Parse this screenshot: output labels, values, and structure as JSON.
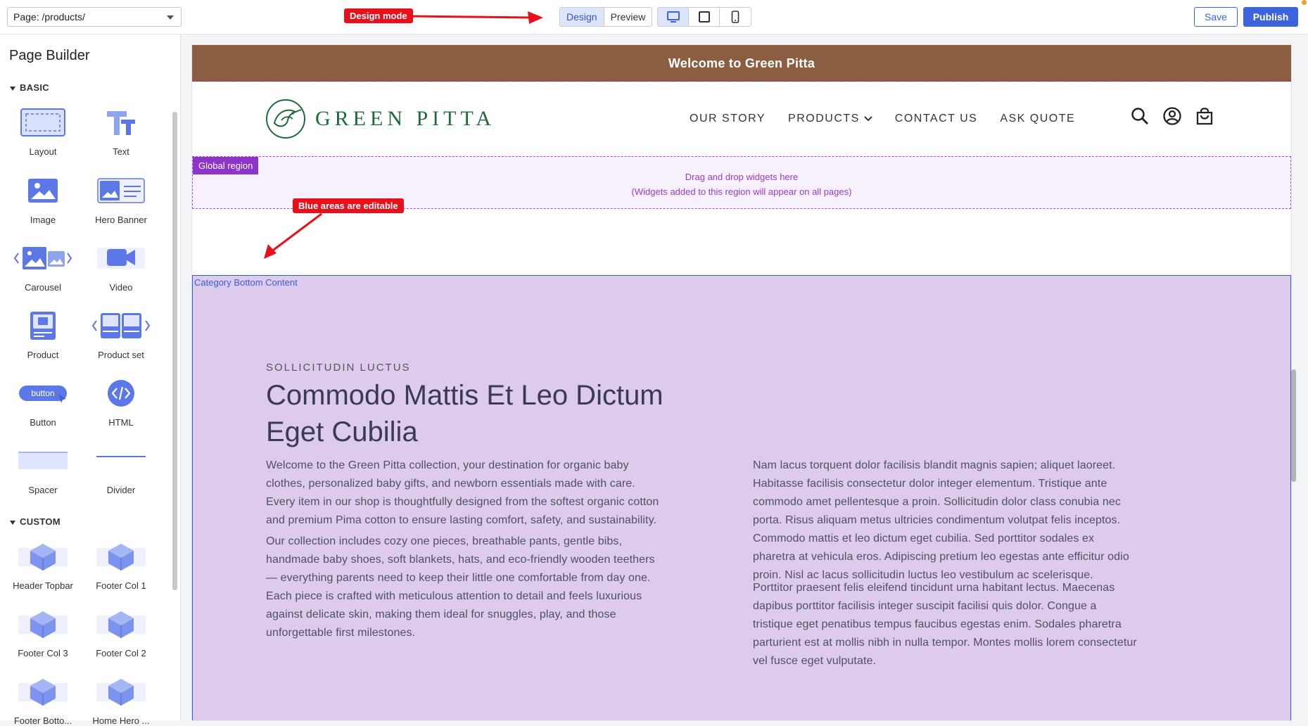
{
  "topbar": {
    "page_select": "Page: /products/",
    "callout_design": "Design mode",
    "mode_design": "Design",
    "mode_preview": "Preview",
    "save": "Save",
    "publish": "Publish"
  },
  "sidebar": {
    "title": "Page Builder",
    "basic_title": "BASIC",
    "custom_title": "CUSTOM",
    "basic": [
      {
        "label": "Layout",
        "icon": "layout-icon"
      },
      {
        "label": "Text",
        "icon": "text-icon"
      },
      {
        "label": "Image",
        "icon": "image-icon"
      },
      {
        "label": "Hero Banner",
        "icon": "hero-banner-icon"
      },
      {
        "label": "Carousel",
        "icon": "carousel-icon"
      },
      {
        "label": "Video",
        "icon": "video-icon"
      },
      {
        "label": "Product",
        "icon": "product-icon"
      },
      {
        "label": "Product set",
        "icon": "product-set-icon"
      },
      {
        "label": "Button",
        "icon": "button-icon",
        "icon_text": "button"
      },
      {
        "label": "HTML",
        "icon": "html-icon"
      },
      {
        "label": "Spacer",
        "icon": "spacer-icon"
      },
      {
        "label": "Divider",
        "icon": "divider-icon"
      }
    ],
    "custom": [
      {
        "label": "Header Topbar"
      },
      {
        "label": "Footer Col 1"
      },
      {
        "label": "Footer Col 3"
      },
      {
        "label": "Footer Col 2"
      },
      {
        "label": "Footer Botto..."
      },
      {
        "label": "Home Hero ..."
      }
    ]
  },
  "canvas": {
    "welcome": "Welcome to Green Pitta",
    "logo_text": "GREEN PITTA",
    "nav": [
      "OUR STORY",
      "PRODUCTS",
      "CONTACT US",
      "ASK QUOTE"
    ],
    "global_tag": "Global region",
    "global_msg_1": "Drag and drop widgets here",
    "global_msg_2": "(Widgets added to this region will appear on all pages)",
    "callout_editable": "Blue areas are editable",
    "editable_label": "Category Bottom Content",
    "eyebrow": "SOLLICITUDIN LUCTUS",
    "heading": "Commodo Mattis Et Leo Dictum Eget Cubilia",
    "para_left_1": "Welcome to the Green Pitta collection, your destination for organic baby clothes, personalized baby gifts, and newborn essentials made with care. Every item in our shop is thoughtfully designed from the softest organic cotton and premium Pima cotton to ensure lasting comfort, safety, and sustainability.",
    "para_left_2": "Our collection includes cozy one pieces, breathable pants, gentle bibs, handmade baby shoes, soft blankets, hats, and eco-friendly wooden teethers — everything parents need to keep their little one comfortable from day one. Each piece is crafted with meticulous attention to detail and feels luxurious against delicate skin, making them ideal for snuggles, play, and those unforgettable first milestones.",
    "para_right_1": "Nam lacus torquent dolor facilisis blandit magnis sapien; aliquet laoreet. Habitasse facilisis consectetur dolor integer elementum. Tristique ante commodo amet pellentesque a proin. Sollicitudin dolor class conubia nec porta. Risus aliquam metus ultricies condimentum volutpat felis inceptos. Commodo mattis et leo dictum eget cubilia. Sed porttitor sodales ex pharetra at vehicula eros. Adipiscing pretium leo egestas ante efficitur odio proin. Nisl ac lacus sollicitudin luctus leo vestibulum ac scelerisque.",
    "para_right_2": "Porttitor praesent felis eleifend tincidunt urna habitant lectus. Maecenas dapibus porttitor facilisis integer suscipit facilisi quis dolor. Congue a tristique eget penatibus tempus faucibus egestas enim. Sodales pharetra parturient est at mollis nibh in nulla tempor. Montes mollis lorem consectetur vel fusce eget vulputate."
  },
  "colors": {
    "accent": "#3d63dd",
    "banner": "#8b5e42",
    "editable_bg": "#dccbec",
    "callout": "#e8101b",
    "brand_green": "#1e6a3a"
  }
}
